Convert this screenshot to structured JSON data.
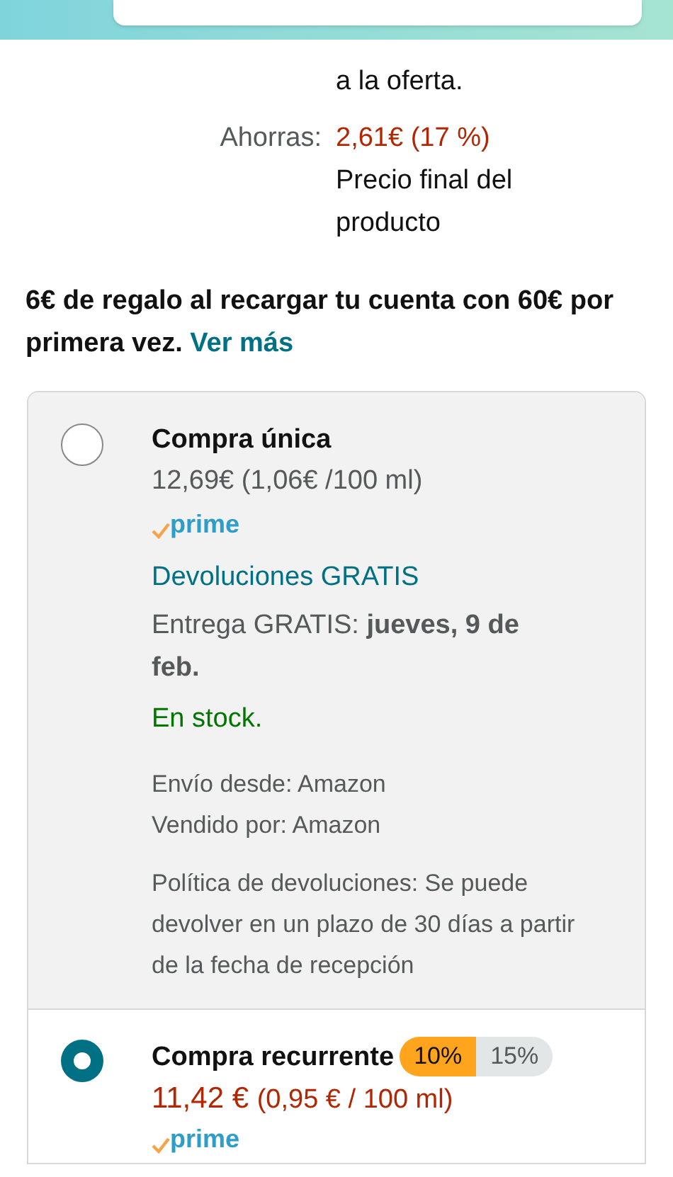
{
  "header": {
    "kind": "search"
  },
  "offer_note": [
    "a la oferta."
  ],
  "savings": {
    "label": "Ahorras:",
    "value": "2,61€ (17 %)",
    "note": "Precio final del producto"
  },
  "promo": {
    "text": "6€ de regalo al recargar tu cuenta con 60€ por primera vez.",
    "link": "Ver más"
  },
  "options": [
    {
      "kind": "one_time",
      "selected": false,
      "title": "Compra única",
      "price": "12,69€ (1,06€ /100 ml)",
      "prime": "prime",
      "returns": "Devoluciones GRATIS",
      "delivery": "Entrega GRATIS: **jueves, 9 de feb.**",
      "stock": "En stock.",
      "ships_from": "Envío desde: Amazon",
      "sold_by": "Vendido por: Amazon",
      "policy": "Política de devoluciones: Se puede devolver en un plazo de 30 días a partir de la fecha de recepción"
    },
    {
      "kind": "subscribe",
      "selected": true,
      "title": "Compra recurrente",
      "tiers": [
        {
          "label": "10%",
          "selected": true
        },
        {
          "label": "15%",
          "selected": false
        }
      ],
      "price_main": "11,42 €",
      "price_unit": "(0,95 € / 100 ml)",
      "prime": "prime"
    }
  ]
}
